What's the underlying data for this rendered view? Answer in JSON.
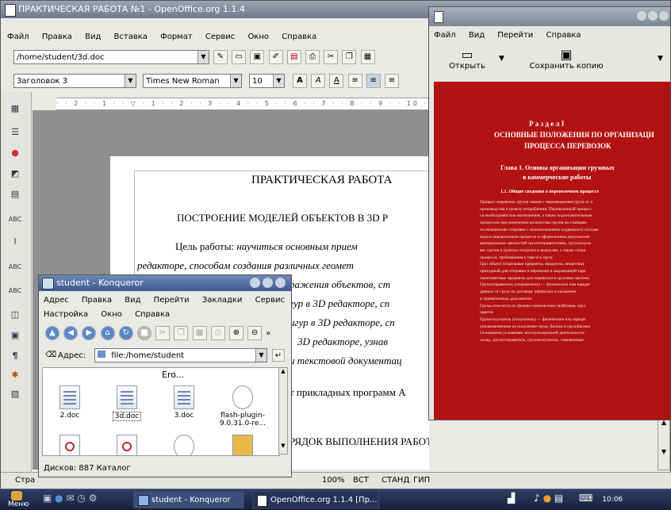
{
  "oo": {
    "title": "ПРАКТИЧЕСКАЯ РАБОТА №1 - OpenOffice.org 1.1.4",
    "menu": [
      "Файл",
      "Правка",
      "Вид",
      "Вставка",
      "Формат",
      "Сервис",
      "Окно",
      "Справка"
    ],
    "path": "/home/student/3d.doc",
    "style": "Заголовок 3",
    "font": "Times New Roman",
    "size": "10",
    "bold": "A",
    "italic": "A",
    "underline": "A",
    "doc": {
      "title": "ПРАКТИЧЕСКАЯ РАБОТА",
      "subtitle": "ПОСТРОЕНИЕ МОДЕЛЕЙ ОБЪЕКТОВ  В 3D Р",
      "para1_plain": "Цель   работы:",
      "para1_it": " научиться   основным   прием",
      "line2": "редакторе,   способам   создания   различных   геомет",
      "line3": "ражения   объектов,   ст",
      "line4": "гур  в  3D  редакторе,  сп",
      "line5": "игур  в  3D  редакторе,  сп",
      "line6": "3D   редакторе,   узнав",
      "line7": "и текстовой документац",
      "line8": "т прикладных программ А",
      "heading2": "РЯДОК ВЫПОЛНЕНИЯ РАБОТЫ:"
    },
    "status": {
      "left": "Стра",
      "zoom": "100%",
      "ins": "ВСТ",
      "std": "СТАНД",
      "hyp": "ГИП"
    }
  },
  "viewer": {
    "menu": [
      "Файл",
      "Вид",
      "Перейти",
      "Справка"
    ],
    "open_label": "Открыть",
    "save_label": "Сохранить копию",
    "page": {
      "section": "Р а з д е л   I",
      "section_title_1": "ОСНОВНЫЕ ПОЛОЖЕНИЯ ПО ОРГАНИЗАЦИ",
      "section_title_2": "ПРОЦЕССА ПЕРЕВОЗОК",
      "chapter_1": "Глава 1. Основы организации грузовых",
      "chapter_2": "в коммерческие работы",
      "sub": "1.1. Общие сведения о перевозочном процессе",
      "body": [
        "Процесс перевозок грузов связан с перемещением груза от п",
        "производства к пункту потребления. Перевозочный процесс",
        "ся необходимостью выполнения, а также подготовительным",
        "процессом при изменении количества грузов на станциях",
        "по назначению отправки с использованием подвижного состава",
        "вида в перевозочном процессе и оформлением документов",
        "материальных ценностей грузоотправителями, грузополуча",
        "вес грузов в пунктах погрузки и выгрузки, а также сохра",
        "процесса, требованиям к таре и к грузу",
        "Груз   объект (отдельные предметы, продукты, вещества)",
        "пригодный для отправки и перевозки в надлежащей таре",
        "тяжеловесные предметы для перевозки в грузовых вагонах",
        "Грузоотправитель (отправитель) — физическое или юриди",
        "данных от груза по договору перевозки и указанное",
        "в перевозочных документах",
        "Грузы относятся по физико-химическим свойствам, груз",
        "чаются",
        "Грузополучатель (получатель) — физическое или юриди",
        "уполномоченное на получение груза, багажа и грузобагажа",
        "Основными условиями эксплуатационной деятельности",
        "склад, грузоотправитель, грузополучатель, таможенные"
      ]
    }
  },
  "konq": {
    "title": "student - Konqueror",
    "menu1": [
      "Адрес",
      "Правка",
      "Вид",
      "Перейти",
      "Закладки",
      "Сервис"
    ],
    "menu2": [
      "Настройка",
      "Окно",
      "Справка"
    ],
    "address_label": "Адрес:",
    "address": "file:/home/student",
    "folder_partial": "Ero...",
    "files": [
      {
        "name": "2.doc",
        "kind": "doc"
      },
      {
        "name": "3d.doc",
        "kind": "doc"
      },
      {
        "name": "3.doc",
        "kind": "doc"
      },
      {
        "name": "flash-plugin-9.0.31.0-re...",
        "kind": "rpm"
      },
      {
        "name": "",
        "kind": "pdf"
      },
      {
        "name": "",
        "kind": "pdf"
      },
      {
        "name": "",
        "kind": "rpm"
      },
      {
        "name": "",
        "kind": "box"
      }
    ],
    "status": "Дисков: 887 Каталог"
  },
  "taskbar": {
    "start": "Меню",
    "tasks": [
      "student - Konqueror",
      "OpenOffice.org 1.1.4 [Пр..."
    ],
    "clock": "10:06"
  },
  "colors": {
    "red_page": "#b31212",
    "taskbar": "#1c2c4c"
  }
}
